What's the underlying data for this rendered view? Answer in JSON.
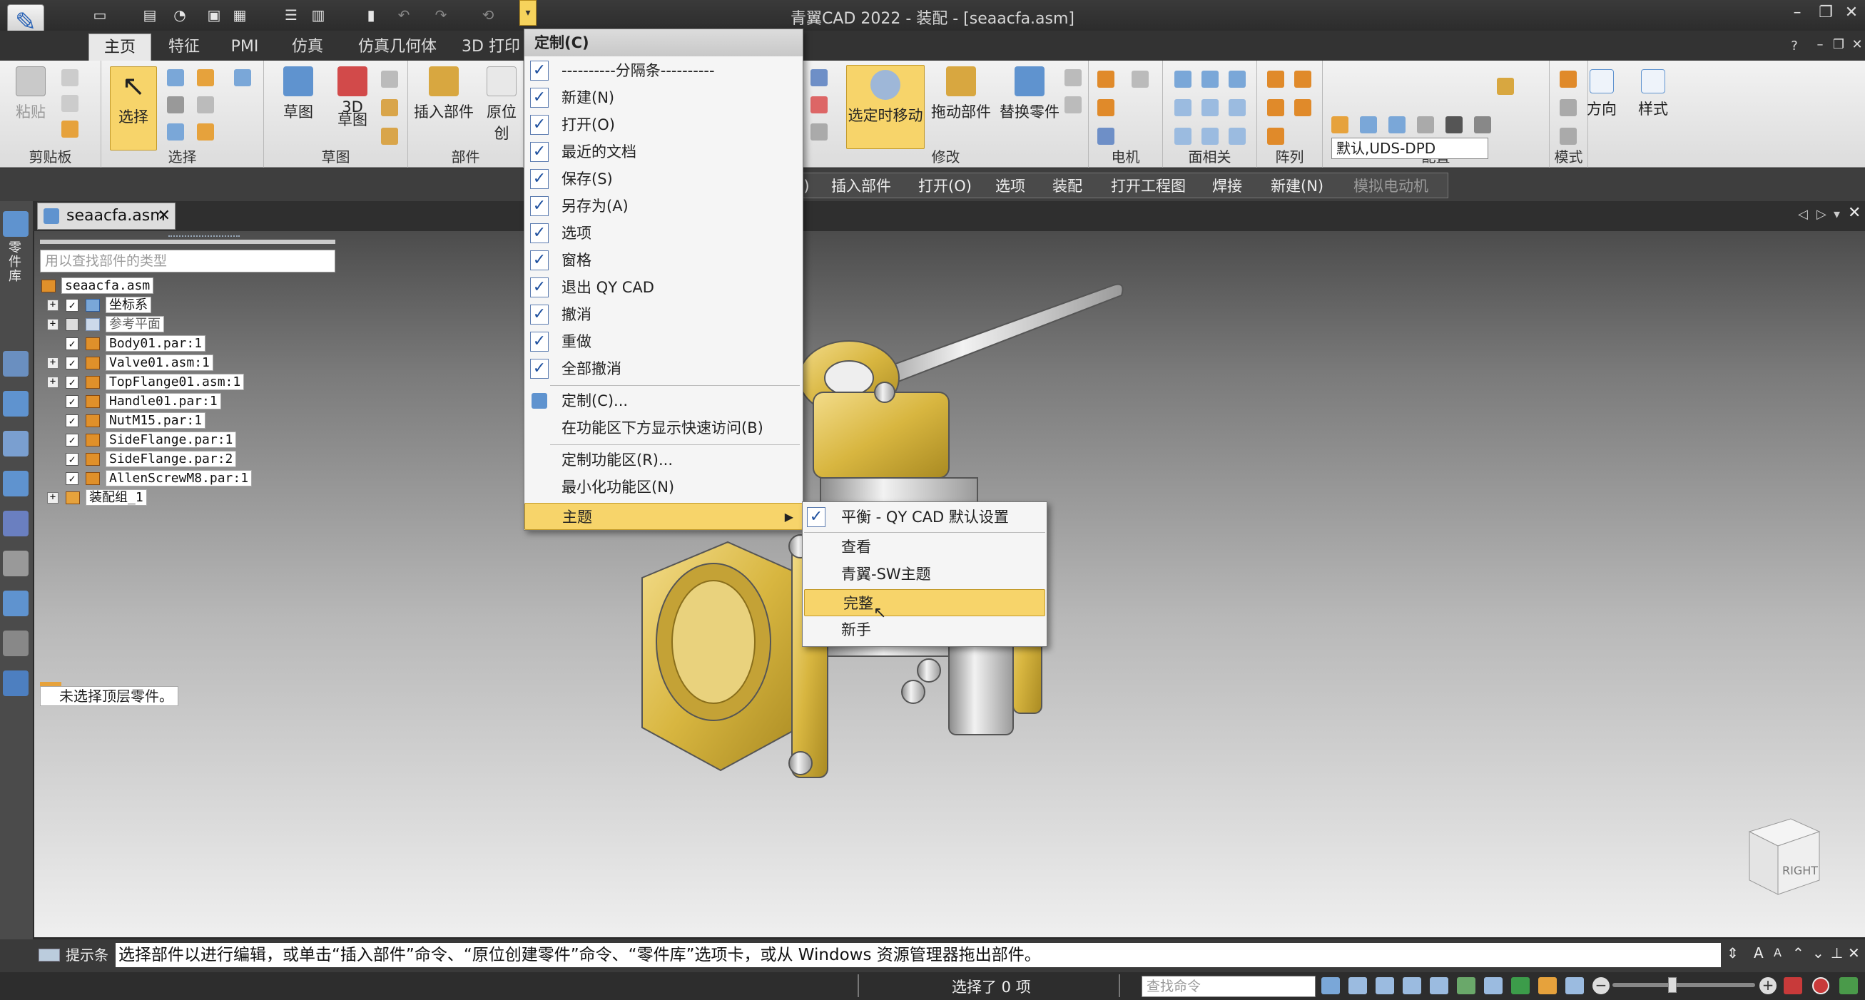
{
  "app": {
    "title": "青翼CAD 2022 - 装配 - [seaacfa.asm]",
    "logo_icon": "pen-logo-icon"
  },
  "tabs": [
    {
      "label": "主页"
    },
    {
      "label": "特征"
    },
    {
      "label": "PMI"
    },
    {
      "label": "仿真"
    },
    {
      "label": "仿真几何体"
    },
    {
      "label": "3D 打印"
    }
  ],
  "ribbon": {
    "groups": {
      "clipboard": "剪贴板",
      "select": "选择",
      "sketch": "草图",
      "parts": "部件",
      "modify": "修改",
      "motor": "电机",
      "face": "面相关",
      "array": "阵列",
      "config": "配置",
      "mode": "模式"
    },
    "buttons": {
      "paste": "粘贴",
      "select": "选择",
      "sketch": "草图",
      "sketch3d": "3D\n草图",
      "insert_part": "插入部件",
      "inplace": "原位创",
      "move_when_selected": "选定时移动",
      "drag_part": "拖动部件",
      "replace_part": "替换零件",
      "direction": "方向",
      "style": "样式"
    },
    "config_combo_value": "默认,UDS-DPD"
  },
  "quick_bar": [
    {
      "label": "S)"
    },
    {
      "label": "插入部件"
    },
    {
      "label": "打开(O)"
    },
    {
      "label": "选项"
    },
    {
      "label": "装配"
    },
    {
      "label": "打开工程图"
    },
    {
      "label": "焊接"
    },
    {
      "label": "新建(N)"
    },
    {
      "label": "模拟电动机"
    }
  ],
  "document_tab": {
    "label": "seaacfa.asm"
  },
  "left_toolbar": {
    "vertical_label": "零件库"
  },
  "pathfinder": {
    "search_placeholder": "用以查找部件的类型",
    "items": [
      {
        "label": "seaacfa.asm"
      },
      {
        "label": "坐标系"
      },
      {
        "label": "参考平面"
      },
      {
        "label": "Body01.par:1"
      },
      {
        "label": "Valve01.asm:1"
      },
      {
        "label": "TopFlange01.asm:1"
      },
      {
        "label": "Handle01.par:1"
      },
      {
        "label": "NutM15.par:1"
      },
      {
        "label": "SideFlange.par:1"
      },
      {
        "label": "SideFlange.par:2"
      },
      {
        "label": "AllenScrewM8.par:1"
      },
      {
        "label": "装配组_1"
      }
    ],
    "status_message": "未选择顶层零件。"
  },
  "customize_menu": {
    "title": "定制(C)",
    "checked_items": [
      {
        "label": "----------分隔条----------"
      },
      {
        "label": "新建(N)"
      },
      {
        "label": "打开(O)"
      },
      {
        "label": "最近的文档"
      },
      {
        "label": "保存(S)"
      },
      {
        "label": "另存为(A)"
      },
      {
        "label": "选项"
      },
      {
        "label": "窗格"
      },
      {
        "label": "退出 QY CAD"
      },
      {
        "label": "撤消"
      },
      {
        "label": "重做"
      },
      {
        "label": "全部撤消"
      }
    ],
    "customize": "定制(C)...",
    "show_below": "在功能区下方显示快速访问(B)",
    "customize_ribbon": "定制功能区(R)...",
    "minimize_ribbon": "最小化功能区(N)",
    "theme": "主题"
  },
  "theme_submenu": {
    "items": [
      {
        "label": "平衡 - QY CAD 默认设置",
        "checked": true
      },
      {
        "label": "查看"
      },
      {
        "label": "青翼-SW主题"
      },
      {
        "label": "完整",
        "highlighted": true
      },
      {
        "label": "新手"
      }
    ]
  },
  "prompt_bar": {
    "label": "提示条",
    "text": "选择部件以进行编辑，或单击“插入部件”命令、“原位创建零件”命令、“零件库”选项卡，或从 Windows 资源管理器拖出部件。"
  },
  "status_bar": {
    "selection_count": "选择了 0 项",
    "command_search_placeholder": "查找命令"
  },
  "view_cube": {
    "face_label": "RIGHT"
  },
  "colors": {
    "accent": "#f7d46a",
    "checkbox_blue": "#1d4f9e",
    "valve_gold": "#d8b640"
  }
}
